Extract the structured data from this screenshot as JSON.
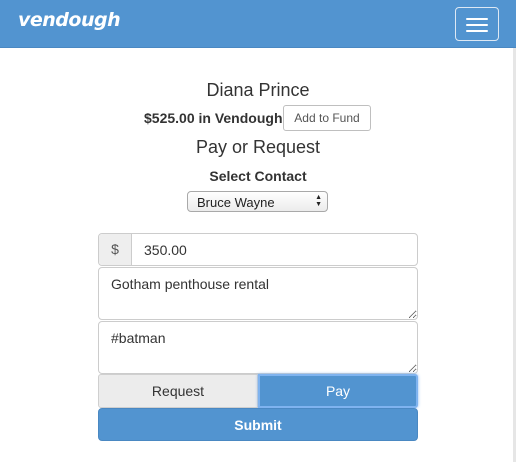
{
  "navbar": {
    "brand": "vendough",
    "menu_icon": "hamburger-menu-icon",
    "color": "#5294d0"
  },
  "profile": {
    "name": "Diana Prince",
    "balance_text": "$525.00 in Vendough",
    "add_fund_label": "Add to Fund"
  },
  "transaction": {
    "title": "Pay or Request",
    "contact_label": "Select Contact",
    "selected_contact": "Bruce Wayne",
    "currency_symbol": "$",
    "amount": "350.00",
    "description": "Gotham penthouse rental",
    "tags": "#batman",
    "request_label": "Request",
    "pay_label": "Pay",
    "active_mode": "Pay",
    "submit_label": "Submit"
  }
}
